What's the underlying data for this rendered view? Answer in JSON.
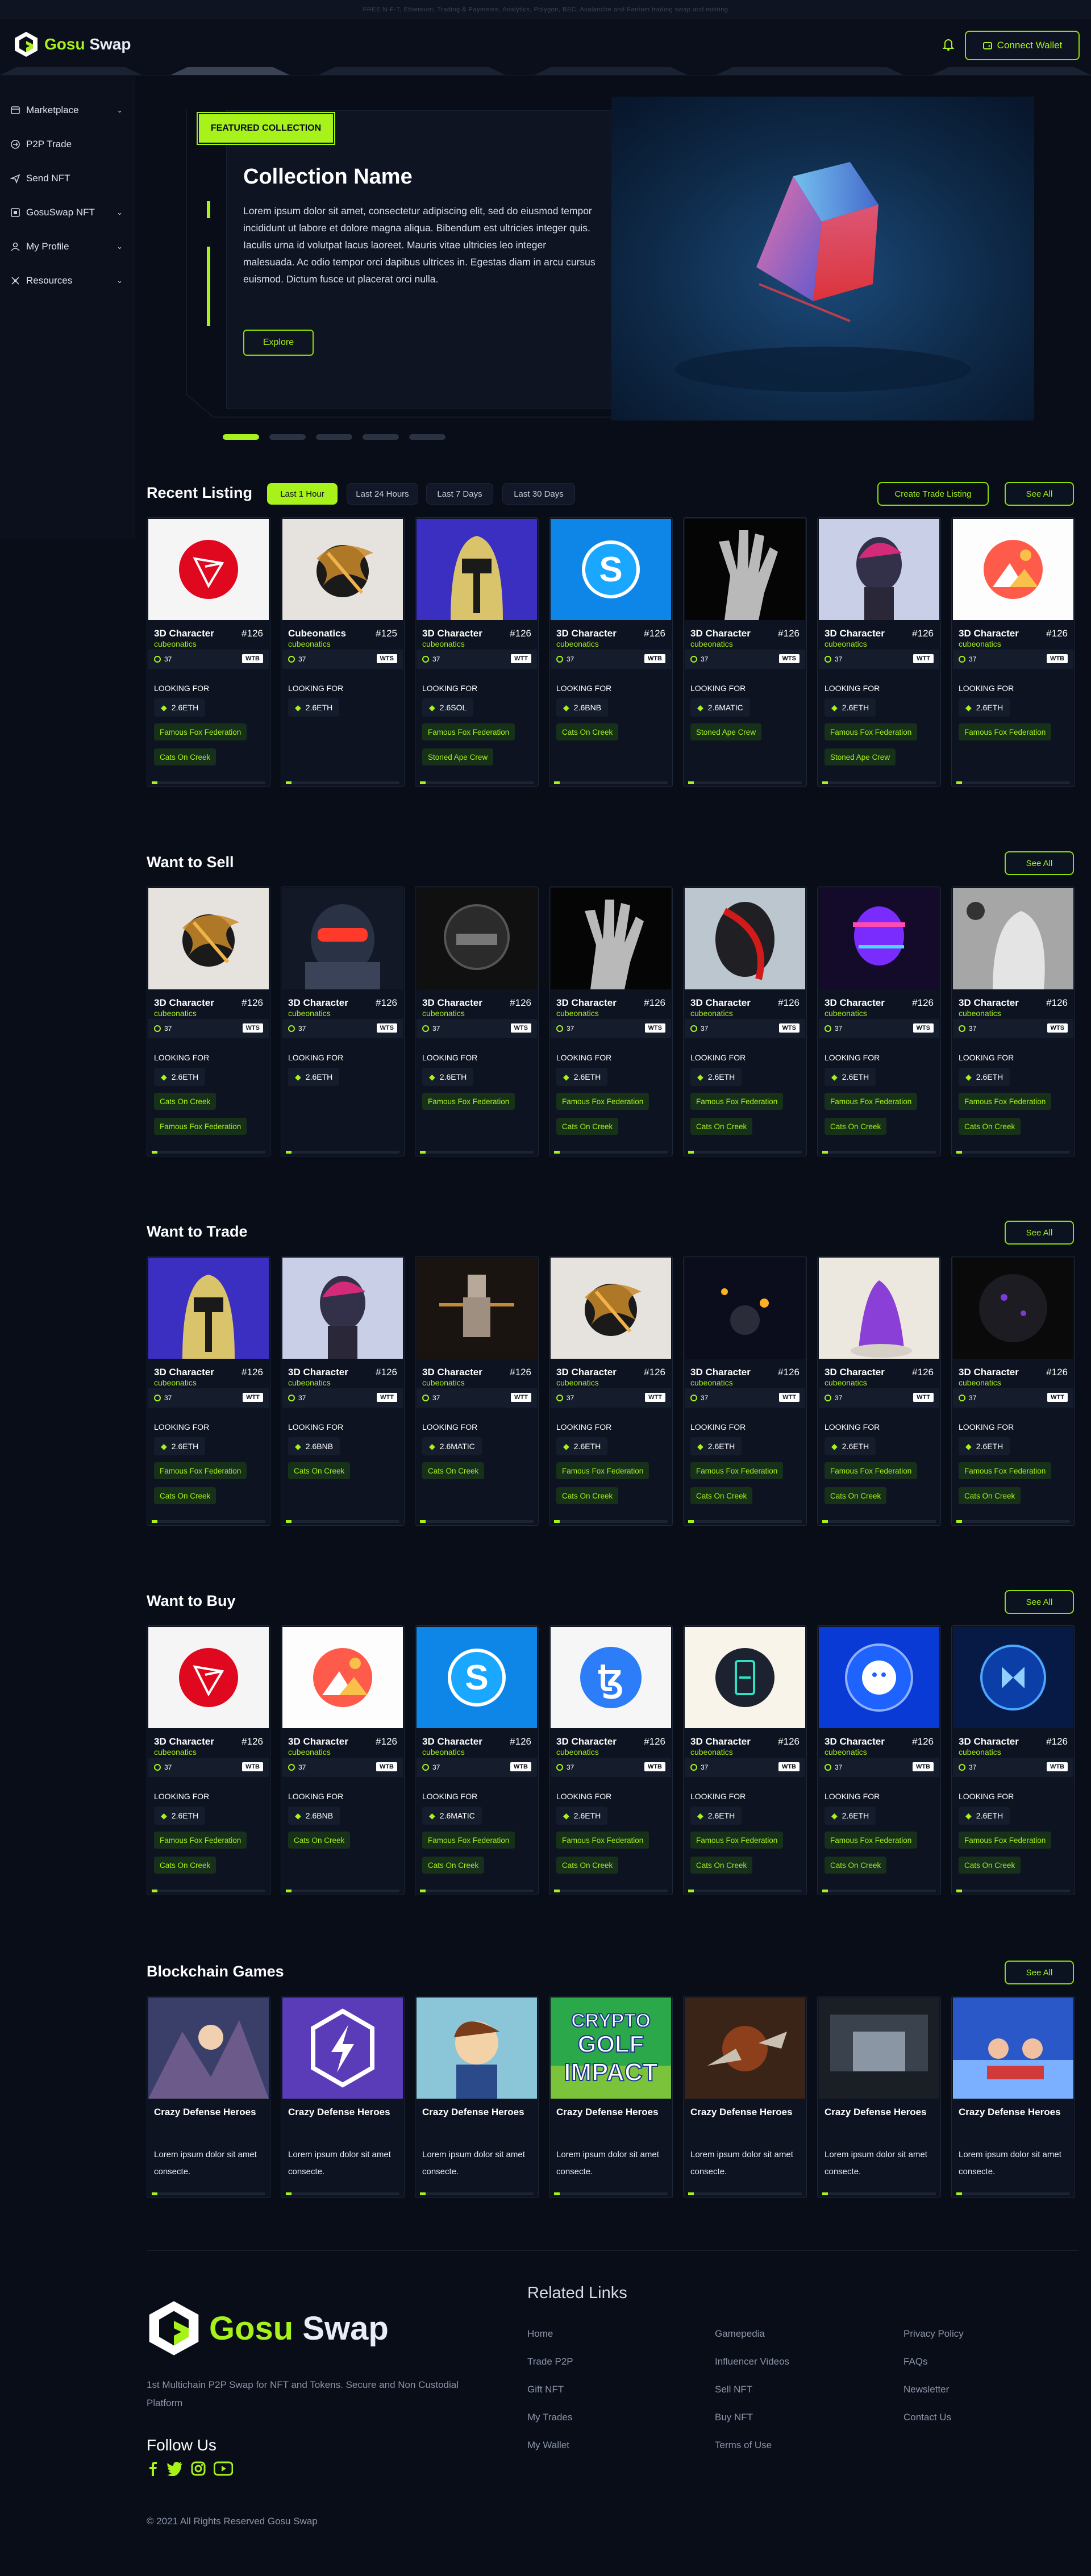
{
  "ticker": "FREE N-F-T, Ethereum, Trading & Payments, Analytics, Polygon, BSC, Avalanche and Fantom trading swap and minting",
  "header": {
    "brand_a": "Gosu",
    "brand_b": "Swap",
    "connect_label": "Connect Wallet",
    "bell_icon": "bell-icon",
    "wallet_icon": "wallet-icon"
  },
  "sidebar": {
    "items": [
      {
        "label": "Marketplace",
        "icon": "marketplace-icon",
        "has_chevron": true
      },
      {
        "label": "P2P Trade",
        "icon": "p2p-icon",
        "has_chevron": false
      },
      {
        "label": "Send NFT",
        "icon": "send-icon",
        "has_chevron": false
      },
      {
        "label": "GosuSwap NFT",
        "icon": "nft-icon",
        "has_chevron": true
      },
      {
        "label": "My Profile",
        "icon": "profile-icon",
        "has_chevron": true
      },
      {
        "label": "Resources",
        "icon": "resources-icon",
        "has_chevron": true
      }
    ],
    "chevron": "⌄"
  },
  "hero": {
    "badge": "FEATURED COLLECTION",
    "title": "Collection Name",
    "description": "Lorem ipsum dolor sit amet, consectetur adipiscing elit, sed do eiusmod tempor incididunt ut labore et dolore magna aliqua. Bibendum est ultricies integer quis. Iaculis urna id volutpat lacus laoreet. Mauris vitae ultricies leo integer malesuada. Ac odio tempor orci dapibus ultrices in. Egestas diam in arcu cursus euismod. Dictum fusce ut placerat orci nulla.",
    "explore_label": "Explore",
    "slides": 5,
    "active_slide": 1
  },
  "recent": {
    "title": "Recent Listing",
    "filters": [
      "Last 1 Hour",
      "Last 24 Hours",
      "Last 7 Days",
      "Last 30 Days"
    ],
    "active_filter": 0,
    "create_label": "Create Trade Listing",
    "see_all": "See All",
    "cards": [
      {
        "name": "3D Character",
        "num": "#126",
        "coll": "cubeonatics",
        "stat": "37",
        "tag": "WTB",
        "lf": "LOOKING FOR",
        "token": "2.6ETH",
        "chips": [
          "Famous Fox Federation",
          "Cats On Creek"
        ],
        "thumb": "tron"
      },
      {
        "name": "Cubeonatics",
        "num": "#125",
        "coll": "cubeonatics",
        "stat": "37",
        "tag": "WTS",
        "lf": "LOOKING FOR",
        "token": "2.6ETH",
        "chips": [],
        "thumb": "gold"
      },
      {
        "name": "3D Character",
        "num": "#126",
        "coll": "cubeonatics",
        "stat": "37",
        "tag": "WTT",
        "lf": "LOOKING FOR",
        "token": "2.6SOL",
        "chips": [
          "Famous Fox Federation",
          "Stoned Ape Crew"
        ],
        "thumb": "helmet"
      },
      {
        "name": "3D Character",
        "num": "#126",
        "coll": "cubeonatics",
        "stat": "37",
        "tag": "WTB",
        "lf": "LOOKING FOR",
        "token": "2.6BNB",
        "chips": [
          "Cats On Creek"
        ],
        "thumb": "s-coin"
      },
      {
        "name": "3D Character",
        "num": "#126",
        "coll": "cubeonatics",
        "stat": "37",
        "tag": "WTS",
        "lf": "LOOKING FOR",
        "token": "2.6MATIC",
        "chips": [
          "Stoned Ape Crew"
        ],
        "thumb": "hand"
      },
      {
        "name": "3D Character",
        "num": "#126",
        "coll": "cubeonatics",
        "stat": "37",
        "tag": "WTT",
        "lf": "LOOKING FOR",
        "token": "2.6ETH",
        "chips": [
          "Famous Fox Federation",
          "Stoned Ape Crew"
        ],
        "thumb": "head"
      },
      {
        "name": "3D Character",
        "num": "#126",
        "coll": "cubeonatics",
        "stat": "37",
        "tag": "WTB",
        "lf": "LOOKING FOR",
        "token": "2.6ETH",
        "chips": [
          "Famous Fox Federation"
        ],
        "thumb": "mana"
      }
    ]
  },
  "sell": {
    "title": "Want to Sell",
    "see_all": "See All",
    "cards": [
      {
        "name": "3D Character",
        "num": "#126",
        "coll": "cubeonatics",
        "stat": "37",
        "tag": "WTS",
        "lf": "LOOKING FOR",
        "token": "2.6ETH",
        "chips": [
          "Cats On Creek",
          "Famous Fox Federation"
        ],
        "thumb": "gold"
      },
      {
        "name": "3D Character",
        "num": "#126",
        "coll": "cubeonatics",
        "stat": "37",
        "tag": "WTS",
        "lf": "LOOKING FOR",
        "token": "2.6ETH",
        "chips": [],
        "thumb": "visor"
      },
      {
        "name": "3D Character",
        "num": "#126",
        "coll": "cubeonatics",
        "stat": "37",
        "tag": "WTS",
        "lf": "LOOKING FOR",
        "token": "2.6ETH",
        "chips": [
          "Famous Fox Federation"
        ],
        "thumb": "blackhelmet"
      },
      {
        "name": "3D Character",
        "num": "#126",
        "coll": "cubeonatics",
        "stat": "37",
        "tag": "WTS",
        "lf": "LOOKING FOR",
        "token": "2.6ETH",
        "chips": [
          "Famous Fox Federation",
          "Cats On Creek"
        ],
        "thumb": "hand"
      },
      {
        "name": "3D Character",
        "num": "#126",
        "coll": "cubeonatics",
        "stat": "37",
        "tag": "WTS",
        "lf": "LOOKING FOR",
        "token": "2.6ETH",
        "chips": [
          "Famous Fox Federation",
          "Cats On Creek"
        ],
        "thumb": "redwrap"
      },
      {
        "name": "3D Character",
        "num": "#126",
        "coll": "cubeonatics",
        "stat": "37",
        "tag": "WTS",
        "lf": "LOOKING FOR",
        "token": "2.6ETH",
        "chips": [
          "Famous Fox Federation",
          "Cats On Creek"
        ],
        "thumb": "glitch"
      },
      {
        "name": "3D Character",
        "num": "#126",
        "coll": "cubeonatics",
        "stat": "37",
        "tag": "WTS",
        "lf": "LOOKING FOR",
        "token": "2.6ETH",
        "chips": [
          "Famous Fox Federation",
          "Cats On Creek"
        ],
        "thumb": "marble"
      }
    ]
  },
  "trade": {
    "title": "Want to Trade",
    "see_all": "See All",
    "cards": [
      {
        "name": "3D Character",
        "num": "#126",
        "coll": "cubeonatics",
        "stat": "37",
        "tag": "WTT",
        "lf": "LOOKING FOR",
        "token": "2.6ETH",
        "chips": [
          "Famous Fox Federation",
          "Cats On Creek"
        ],
        "thumb": "helmet"
      },
      {
        "name": "3D Character",
        "num": "#126",
        "coll": "cubeonatics",
        "stat": "37",
        "tag": "WTT",
        "lf": "LOOKING FOR",
        "token": "2.6BNB",
        "chips": [
          "Cats On Creek"
        ],
        "thumb": "head"
      },
      {
        "name": "3D Character",
        "num": "#126",
        "coll": "cubeonatics",
        "stat": "37",
        "tag": "WTT",
        "lf": "LOOKING FOR",
        "token": "2.6MATIC",
        "chips": [
          "Cats On Creek"
        ],
        "thumb": "robot"
      },
      {
        "name": "3D Character",
        "num": "#126",
        "coll": "cubeonatics",
        "stat": "37",
        "tag": "WTT",
        "lf": "LOOKING FOR",
        "token": "2.6ETH",
        "chips": [
          "Famous Fox Federation",
          "Cats On Creek"
        ],
        "thumb": "gold"
      },
      {
        "name": "3D Character",
        "num": "#126",
        "coll": "cubeonatics",
        "stat": "37",
        "tag": "WTT",
        "lf": "LOOKING FOR",
        "token": "2.6ETH",
        "chips": [
          "Famous Fox Federation",
          "Cats On Creek"
        ],
        "thumb": "orbs"
      },
      {
        "name": "3D Character",
        "num": "#126",
        "coll": "cubeonatics",
        "stat": "37",
        "tag": "WTT",
        "lf": "LOOKING FOR",
        "token": "2.6ETH",
        "chips": [
          "Famous Fox Federation",
          "Cats On Creek"
        ],
        "thumb": "purple"
      },
      {
        "name": "3D Character",
        "num": "#126",
        "coll": "cubeonatics",
        "stat": "37",
        "tag": "WTT",
        "lf": "LOOKING FOR",
        "token": "2.6ETH",
        "chips": [
          "Famous Fox Federation",
          "Cats On Creek"
        ],
        "thumb": "sphere"
      }
    ]
  },
  "buy": {
    "title": "Want to Buy",
    "see_all": "See All",
    "cards": [
      {
        "name": "3D Character",
        "num": "#126",
        "coll": "cubeonatics",
        "stat": "37",
        "tag": "WTB",
        "lf": "LOOKING FOR",
        "token": "2.6ETH",
        "chips": [
          "Famous Fox Federation",
          "Cats On Creek"
        ],
        "thumb": "tron"
      },
      {
        "name": "3D Character",
        "num": "#126",
        "coll": "cubeonatics",
        "stat": "37",
        "tag": "WTB",
        "lf": "LOOKING FOR",
        "token": "2.6BNB",
        "chips": [
          "Cats On Creek"
        ],
        "thumb": "mana"
      },
      {
        "name": "3D Character",
        "num": "#126",
        "coll": "cubeonatics",
        "stat": "37",
        "tag": "WTB",
        "lf": "LOOKING FOR",
        "token": "2.6MATIC",
        "chips": [
          "Famous Fox Federation",
          "Cats On Creek"
        ],
        "thumb": "s-coin"
      },
      {
        "name": "3D Character",
        "num": "#126",
        "coll": "cubeonatics",
        "stat": "37",
        "tag": "WTB",
        "lf": "LOOKING FOR",
        "token": "2.6ETH",
        "chips": [
          "Famous Fox Federation",
          "Cats On Creek"
        ],
        "thumb": "tezos"
      },
      {
        "name": "3D Character",
        "num": "#126",
        "coll": "cubeonatics",
        "stat": "37",
        "tag": "WTB",
        "lf": "LOOKING FOR",
        "token": "2.6ETH",
        "chips": [
          "Famous Fox Federation",
          "Cats On Creek"
        ],
        "thumb": "theta"
      },
      {
        "name": "3D Character",
        "num": "#126",
        "coll": "cubeonatics",
        "stat": "37",
        "tag": "WTB",
        "lf": "LOOKING FOR",
        "token": "2.6ETH",
        "chips": [
          "Famous Fox Federation",
          "Cats On Creek"
        ],
        "thumb": "ape"
      },
      {
        "name": "3D Character",
        "num": "#126",
        "coll": "cubeonatics",
        "stat": "37",
        "tag": "WTB",
        "lf": "LOOKING FOR",
        "token": "2.6ETH",
        "chips": [
          "Famous Fox Federation",
          "Cats On Creek"
        ],
        "thumb": "bluechip"
      }
    ]
  },
  "games": {
    "title": "Blockchain Games",
    "see_all": "See All",
    "cards": [
      {
        "name": "Crazy Defense Heroes",
        "desc": "Lorem ipsum dolor sit amet consecte.",
        "thumb": "anime1"
      },
      {
        "name": "Crazy Defense Heroes",
        "desc": "Lorem ipsum dolor sit amet consecte.",
        "thumb": "bolt"
      },
      {
        "name": "Crazy Defense Heroes",
        "desc": "Lorem ipsum dolor sit amet consecte.",
        "thumb": "anime2"
      },
      {
        "name": "Crazy Defense Heroes",
        "desc": "Lorem ipsum dolor sit amet consecte.",
        "thumb": "golf"
      },
      {
        "name": "Crazy Defense Heroes",
        "desc": "Lorem ipsum dolor sit amet consecte.",
        "thumb": "ships"
      },
      {
        "name": "Crazy Defense Heroes",
        "desc": "Lorem ipsum dolor sit amet consecte.",
        "thumb": "scifi"
      },
      {
        "name": "Crazy Defense Heroes",
        "desc": "Lorem ipsum dolor sit amet consecte.",
        "thumb": "kart"
      }
    ],
    "golf_title_a": "CRYPTO",
    "golf_title_b": "GOLF",
    "golf_title_c": "IMPACT"
  },
  "footer": {
    "brand_a": "Gosu",
    "brand_b": "Swap",
    "tagline": "1st Multichain P2P Swap for NFT and Tokens. Secure and Non Custodial Platform",
    "follow": "Follow Us",
    "socials": [
      "facebook-icon",
      "twitter-icon",
      "instagram-icon",
      "youtube-icon"
    ],
    "related_title": "Related Links",
    "col1": [
      "Home",
      "Trade P2P",
      "Gift NFT",
      "My Trades",
      "My Wallet"
    ],
    "col2": [
      "Gamepedia",
      "Influencer Videos",
      "Sell NFT",
      "Buy NFT",
      "Terms of Use"
    ],
    "col3": [
      "Privacy Policy",
      "FAQs",
      "Newsletter",
      "Contact Us"
    ],
    "copyright": "© 2021 All Rights Reserved Gosu Swap"
  },
  "colors": {
    "accent": "#a7f21a",
    "bg": "#080d18",
    "card": "#0d1320",
    "chip": "#16301a"
  }
}
